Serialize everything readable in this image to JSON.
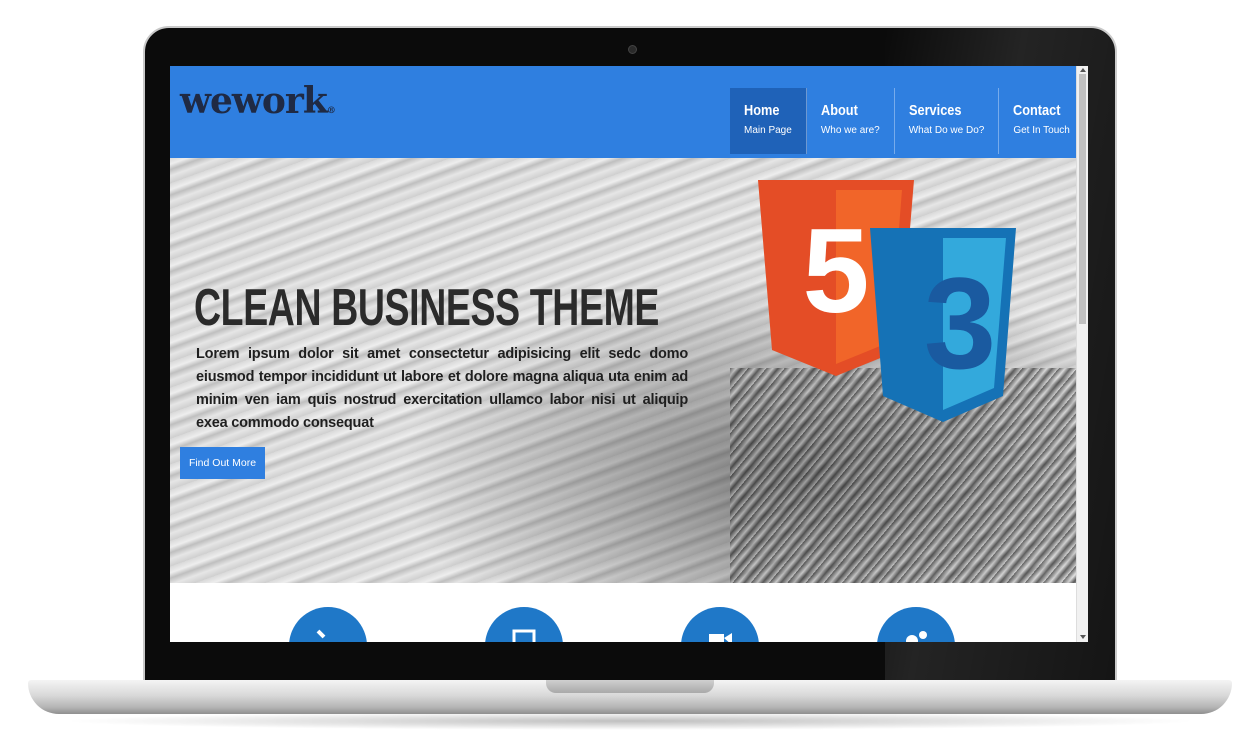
{
  "brand": {
    "logo_text": "wework",
    "logo_mark": "®"
  },
  "nav": {
    "items": [
      {
        "title": "Home",
        "subtitle": "Main Page",
        "active": true
      },
      {
        "title": "About",
        "subtitle": "Who we are?",
        "active": false
      },
      {
        "title": "Services",
        "subtitle": "What Do we Do?",
        "active": false
      },
      {
        "title": "Contact",
        "subtitle": "Get In Touch",
        "active": false
      }
    ]
  },
  "hero": {
    "title": "CLEAN BUSINESS THEME",
    "text": "Lorem ipsum dolor sit amet consectetur adipisicing elit sedc domo eiusmod tempor incididunt ut labore et dolore magna aliqua uta enim ad minim ven iam quis nostrud exercitation ullamco labor nisi ut aliquip exea commodo consequat",
    "button_label": "Find Out More",
    "html5_badge_digit": "5",
    "css3_badge_digit": "3"
  },
  "features": {
    "icons": [
      "phone-icon",
      "monitor-icon",
      "video-camera-icon",
      "gears-icon"
    ]
  },
  "colors": {
    "accent": "#2f7fe0",
    "active_nav": "#1f62b8",
    "html5_orange": "#e44d26",
    "css3_blue": "#1572b6",
    "feature_blue": "#1f78c8"
  }
}
